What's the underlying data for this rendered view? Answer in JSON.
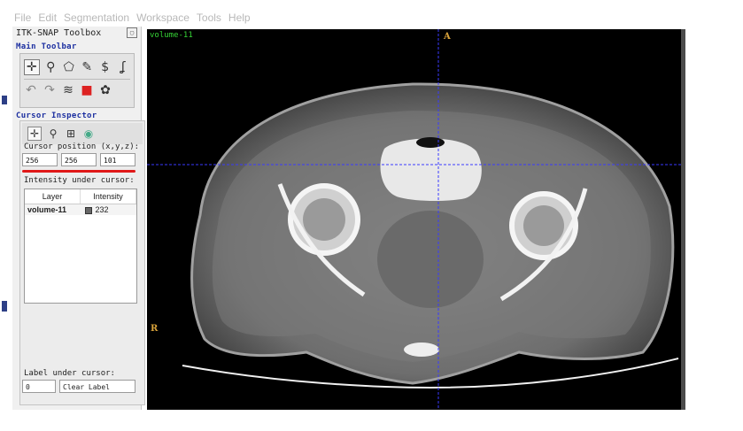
{
  "menu": [
    "File",
    "Edit",
    "Segmentation",
    "Workspace",
    "Tools",
    "Help"
  ],
  "toolbox": {
    "title": "ITK-SNAP Toolbox",
    "main_toolbar_label": "Main Toolbar",
    "tools_row1": [
      "crosshair-icon",
      "zoom-icon",
      "polygon-icon",
      "paintbrush-icon",
      "snake-icon",
      "annotation-icon"
    ],
    "tools_row2": [
      "undo-icon",
      "redo-icon",
      "layers-icon",
      "label-icon",
      "palette-icon"
    ],
    "cursor_inspector_label": "Cursor Inspector",
    "cursor_position_label": "Cursor position (x,y,z):",
    "cursor_x": "256",
    "cursor_y": "256",
    "cursor_z": "101",
    "intensity_label": "Intensity under cursor:",
    "layer_table": {
      "headers": [
        "Layer",
        "Intensity"
      ],
      "rows": [
        {
          "layer": "volume-11",
          "intensity": "232"
        }
      ]
    },
    "label_under_cursor": "Label under cursor:",
    "label_id": "0",
    "label_name": "Clear Label"
  },
  "viewer": {
    "layer_name": "volume-11",
    "orient_top": "A",
    "orient_left": "R",
    "crosshair_color": "#3a3aff"
  }
}
